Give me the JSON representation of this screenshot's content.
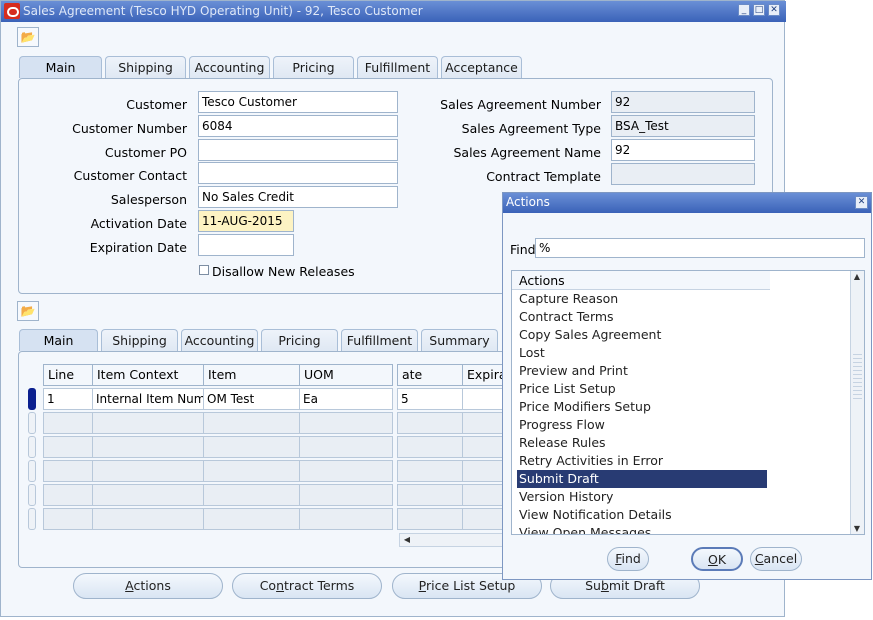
{
  "window": {
    "title": "Sales Agreement (Tesco HYD Operating Unit) - 92, Tesco Customer"
  },
  "header_tabs": [
    "Main",
    "Shipping",
    "Accounting",
    "Pricing",
    "Fulfillment",
    "Acceptance"
  ],
  "header": {
    "customer_label": "Customer",
    "customer_value": "Tesco Customer",
    "customer_number_label": "Customer Number",
    "customer_number_value": "6084",
    "customer_po_label": "Customer PO",
    "customer_po_value": "",
    "customer_contact_label": "Customer Contact",
    "customer_contact_value": "",
    "salesperson_label": "Salesperson",
    "salesperson_value": "No Sales Credit",
    "activation_date_label": "Activation Date",
    "activation_date_value": "11-AUG-2015",
    "expiration_date_label": "Expiration Date",
    "expiration_date_value": "",
    "disallow_label": "Disallow New Releases",
    "sa_number_label": "Sales Agreement Number",
    "sa_number_value": "92",
    "sa_type_label": "Sales Agreement Type",
    "sa_type_value": "BSA_Test",
    "sa_name_label": "Sales Agreement Name",
    "sa_name_value": "92",
    "contract_template_label": "Contract Template",
    "contract_template_value": ""
  },
  "line_tabs": [
    "Main",
    "Shipping",
    "Accounting",
    "Pricing",
    "Fulfillment",
    "Summary"
  ],
  "lines": {
    "columns": [
      "Line",
      "Item Context",
      "Item",
      "UOM",
      "ate",
      "Expira"
    ],
    "rows": [
      [
        "1",
        "Internal Item Numb",
        "OM Test",
        "Ea",
        "5",
        ""
      ]
    ]
  },
  "bottom_buttons": {
    "actions": {
      "pre": "",
      "key": "A",
      "post": "ctions"
    },
    "contract_terms": {
      "pre": "Co",
      "key": "n",
      "post": "tract Terms"
    },
    "price_list_setup": {
      "pre": "",
      "key": "P",
      "post": "rice List Setup"
    },
    "submit_draft": {
      "pre": "Su",
      "key": "b",
      "post": "mit Draft"
    }
  },
  "actions_dialog": {
    "title": "Actions",
    "find_label": "Find",
    "find_value": "%",
    "list_header": "Actions",
    "items": [
      "Capture Reason",
      "Contract Terms",
      "Copy Sales Agreement",
      "Lost",
      "Preview and Print",
      "Price List Setup",
      "Price Modifiers Setup",
      "Progress Flow",
      "Release Rules",
      "Retry Activities in Error",
      "Submit Draft",
      "Version History",
      "View Notification Details",
      "View Open Messages"
    ],
    "selected": "Submit Draft",
    "find_button": {
      "pre": "",
      "key": "F",
      "post": "ind"
    },
    "ok_button": {
      "pre": "",
      "key": "O",
      "post": "K"
    },
    "cancel_button": {
      "pre": "",
      "key": "C",
      "post": "ancel"
    }
  }
}
